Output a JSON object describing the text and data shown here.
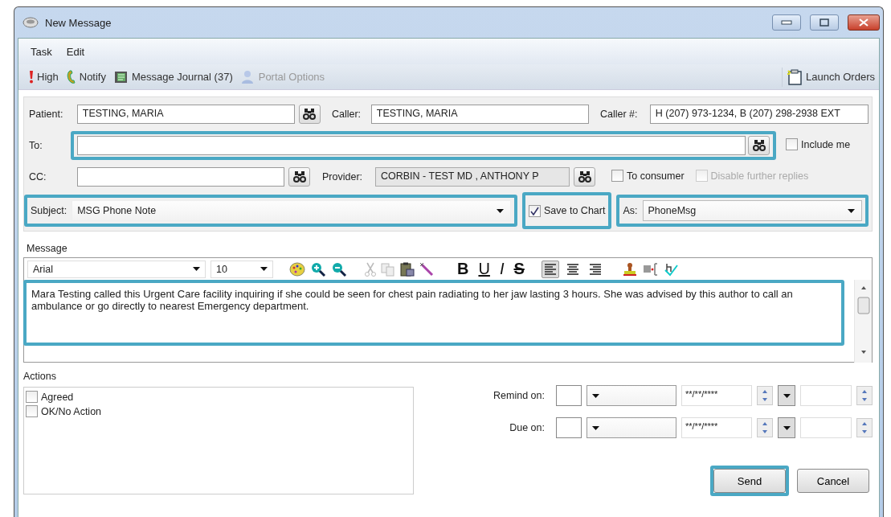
{
  "window": {
    "title": "New Message"
  },
  "menu": [
    "Task",
    "Edit"
  ],
  "toolbar": [
    {
      "kind": "priority",
      "label": "High",
      "disabled": false
    },
    {
      "kind": "notify",
      "label": "Notify",
      "disabled": false
    },
    {
      "kind": "journal",
      "label": "Message Journal (37)",
      "disabled": false
    },
    {
      "kind": "portal",
      "label": "Portal Options",
      "disabled": true
    }
  ],
  "launch_orders": "Launch Orders",
  "patient": {
    "label": "Patient:",
    "value": "TESTING, MARIA"
  },
  "caller": {
    "label": "Caller:",
    "value": "TESTING, MARIA"
  },
  "caller_number": {
    "label": "Caller #:",
    "value": "H (207) 973-1234, B (207) 298-2938 EXT"
  },
  "to": {
    "label": "To:",
    "highlighted": true
  },
  "include_me": {
    "label": "Include me",
    "checked": false,
    "disabled": false
  },
  "cc": {
    "label": "CC:"
  },
  "provider": {
    "label": "Provider:",
    "value": "CORBIN - TEST MD , ANTHONY P"
  },
  "to_consumer": {
    "label": "To consumer",
    "checked": false,
    "disabled": false
  },
  "disable_replies": {
    "label": "Disable further replies",
    "checked": false,
    "disabled": true
  },
  "subject": {
    "label": "Subject:",
    "value": "MSG Phone Note",
    "highlighted": true
  },
  "save_to_chart": {
    "label": "Save to Chart",
    "checked": true,
    "disabled": false,
    "highlighted": true
  },
  "as": {
    "label": "As:",
    "value": "PhoneMsg",
    "highlighted": true
  },
  "message": {
    "label": "Message",
    "font": "Arial",
    "size": "10",
    "format_buttons": [
      {
        "kind": "bold",
        "label": "B"
      },
      {
        "kind": "underline",
        "label": "U"
      },
      {
        "kind": "italic",
        "label": "I"
      },
      {
        "kind": "strike",
        "label": "S"
      }
    ],
    "alignment": [
      {
        "kind": "left",
        "selected": true
      },
      {
        "kind": "center",
        "selected": false
      },
      {
        "kind": "right",
        "selected": false
      }
    ],
    "body": "Mara Testing called this Urgent Care facility inquiring if she could be seen for chest pain radiating to her jaw lasting 3 hours. She was advised by this author to call an ambulance or go directly to nearest Emergency department.",
    "highlighted": true
  },
  "actions": {
    "label": "Actions",
    "items": [
      {
        "label": "Agreed",
        "checked": false
      },
      {
        "label": "OK/No Action",
        "checked": false
      }
    ]
  },
  "reminders": [
    {
      "label": "Remind on:",
      "date": "**/**/****"
    },
    {
      "label": "Due on:",
      "date": "**/**/****"
    }
  ],
  "buttons": [
    {
      "label": "Send",
      "highlighted": true
    },
    {
      "label": "Cancel",
      "highlighted": false
    }
  ]
}
